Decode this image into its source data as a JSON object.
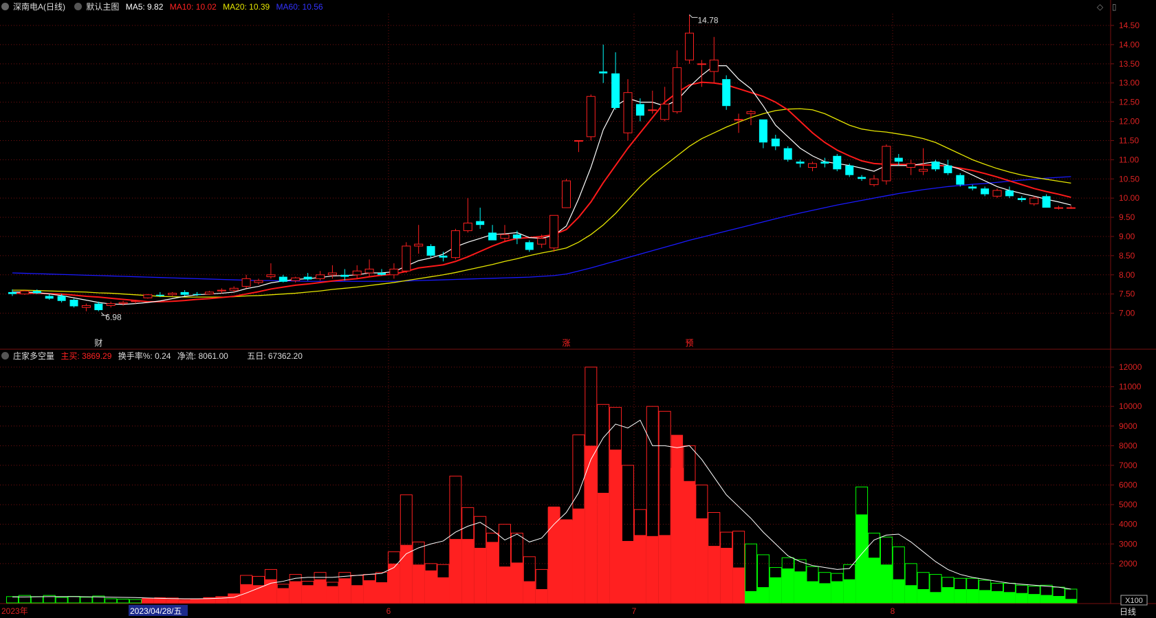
{
  "header": {
    "stock_name": "深南电A(日线)",
    "main_chart_label": "默认主图",
    "ma5": "MA5: 9.82",
    "ma10": "MA10: 10.02",
    "ma20": "MA20: 10.39",
    "ma60": "MA60: 10.56"
  },
  "indicator_header": {
    "name": "庄家多空量",
    "main_buy": "主买: 3869.29",
    "turnover": "换手率%: 0.24",
    "net_flow": "净流: 8061.00",
    "five_day": "五日: 67362.20"
  },
  "price_axis": {
    "ticks": [
      "14.50",
      "14.00",
      "13.50",
      "13.00",
      "12.50",
      "12.00",
      "11.50",
      "11.00",
      "10.50",
      "10.00",
      "9.50",
      "9.00",
      "8.50",
      "8.00",
      "7.50",
      "7.00"
    ],
    "max_label": "14.78",
    "min_label": "6.98"
  },
  "volume_axis": {
    "ticks": [
      "12000",
      "11000",
      "10000",
      "9000",
      "8000",
      "7000",
      "6000",
      "5000",
      "4000",
      "3000",
      "2000"
    ],
    "unit": "X100"
  },
  "time_axis": {
    "labels": [
      "2023年",
      "2023/04/28/五",
      "6",
      "7",
      "8"
    ]
  },
  "markers": {
    "cai": "财",
    "zhang": "涨",
    "yu": "预"
  },
  "footer": {
    "period": "日线"
  },
  "colors": {
    "up": "#ff2020",
    "down": "#00ffff",
    "ma5": "#ffffff",
    "ma10": "#ff1a1a",
    "ma20": "#e6e600",
    "ma60": "#1a1aff",
    "vol_down": "#00ff00",
    "grid": "#7a1010"
  },
  "chart_data": {
    "type": "candlestick",
    "candles": [
      {
        "o": 7.55,
        "h": 7.62,
        "l": 7.45,
        "c": 7.5
      },
      {
        "o": 7.5,
        "h": 7.6,
        "l": 7.48,
        "c": 7.58
      },
      {
        "o": 7.58,
        "h": 7.62,
        "l": 7.5,
        "c": 7.52
      },
      {
        "o": 7.45,
        "h": 7.5,
        "l": 7.35,
        "c": 7.38
      },
      {
        "o": 7.45,
        "h": 7.5,
        "l": 7.28,
        "c": 7.32
      },
      {
        "o": 7.35,
        "h": 7.38,
        "l": 7.15,
        "c": 7.18
      },
      {
        "o": 7.15,
        "h": 7.25,
        "l": 7.05,
        "c": 7.2
      },
      {
        "o": 7.25,
        "h": 7.3,
        "l": 7.05,
        "c": 7.08
      },
      {
        "o": 7.2,
        "h": 7.3,
        "l": 7.15,
        "c": 7.25
      },
      {
        "o": 7.25,
        "h": 7.32,
        "l": 7.2,
        "c": 7.28
      },
      {
        "o": 7.3,
        "h": 7.35,
        "l": 7.25,
        "c": 7.32
      },
      {
        "o": 7.4,
        "h": 7.5,
        "l": 7.38,
        "c": 7.48
      },
      {
        "o": 7.48,
        "h": 7.55,
        "l": 7.42,
        "c": 7.45
      },
      {
        "o": 7.48,
        "h": 7.55,
        "l": 7.45,
        "c": 7.52
      },
      {
        "o": 7.55,
        "h": 7.6,
        "l": 7.45,
        "c": 7.48
      },
      {
        "o": 7.5,
        "h": 7.55,
        "l": 7.45,
        "c": 7.48
      },
      {
        "o": 7.5,
        "h": 7.58,
        "l": 7.48,
        "c": 7.55
      },
      {
        "o": 7.58,
        "h": 7.65,
        "l": 7.52,
        "c": 7.6
      },
      {
        "o": 7.6,
        "h": 7.7,
        "l": 7.55,
        "c": 7.65
      },
      {
        "o": 7.7,
        "h": 8.0,
        "l": 7.65,
        "c": 7.9
      },
      {
        "o": 7.8,
        "h": 7.9,
        "l": 7.75,
        "c": 7.85
      },
      {
        "o": 7.95,
        "h": 8.3,
        "l": 7.9,
        "c": 8.0
      },
      {
        "o": 7.95,
        "h": 8.0,
        "l": 7.8,
        "c": 7.82
      },
      {
        "o": 7.85,
        "h": 7.95,
        "l": 7.8,
        "c": 7.92
      },
      {
        "o": 7.95,
        "h": 8.05,
        "l": 7.85,
        "c": 7.88
      },
      {
        "o": 7.9,
        "h": 8.1,
        "l": 7.85,
        "c": 8.0
      },
      {
        "o": 8.0,
        "h": 8.25,
        "l": 7.9,
        "c": 8.05
      },
      {
        "o": 8.0,
        "h": 8.15,
        "l": 7.85,
        "c": 7.95
      },
      {
        "o": 8.0,
        "h": 8.25,
        "l": 7.9,
        "c": 8.1
      },
      {
        "o": 8.05,
        "h": 8.4,
        "l": 7.95,
        "c": 8.15
      },
      {
        "o": 8.05,
        "h": 8.15,
        "l": 7.98,
        "c": 8.0
      },
      {
        "o": 8.0,
        "h": 8.3,
        "l": 7.9,
        "c": 8.15
      },
      {
        "o": 8.1,
        "h": 8.85,
        "l": 8.05,
        "c": 8.75
      },
      {
        "o": 8.75,
        "h": 9.3,
        "l": 8.55,
        "c": 8.8
      },
      {
        "o": 8.75,
        "h": 8.8,
        "l": 8.45,
        "c": 8.5
      },
      {
        "o": 8.5,
        "h": 8.6,
        "l": 8.35,
        "c": 8.45
      },
      {
        "o": 8.45,
        "h": 9.2,
        "l": 8.4,
        "c": 9.15
      },
      {
        "o": 9.15,
        "h": 10.0,
        "l": 9.1,
        "c": 9.35
      },
      {
        "o": 9.4,
        "h": 9.75,
        "l": 9.2,
        "c": 9.3
      },
      {
        "o": 9.1,
        "h": 9.3,
        "l": 8.9,
        "c": 8.9
      },
      {
        "o": 8.95,
        "h": 9.3,
        "l": 8.85,
        "c": 9.05
      },
      {
        "o": 9.05,
        "h": 9.15,
        "l": 8.8,
        "c": 8.95
      },
      {
        "o": 8.85,
        "h": 8.9,
        "l": 8.6,
        "c": 8.65
      },
      {
        "o": 8.8,
        "h": 9.05,
        "l": 8.7,
        "c": 8.95
      },
      {
        "o": 8.7,
        "h": 9.55,
        "l": 8.6,
        "c": 9.55
      },
      {
        "o": 9.75,
        "h": 10.5,
        "l": 9.75,
        "c": 10.45
      },
      {
        "o": 11.5,
        "h": 11.5,
        "l": 11.2,
        "c": 11.5
      },
      {
        "o": 11.6,
        "h": 12.7,
        "l": 11.5,
        "c": 12.65
      },
      {
        "o": 13.3,
        "h": 14.0,
        "l": 13.0,
        "c": 13.25
      },
      {
        "o": 13.25,
        "h": 13.8,
        "l": 12.3,
        "c": 12.35
      },
      {
        "o": 11.7,
        "h": 13.1,
        "l": 11.5,
        "c": 12.75
      },
      {
        "o": 12.45,
        "h": 12.6,
        "l": 12.0,
        "c": 12.15
      },
      {
        "o": 12.3,
        "h": 12.8,
        "l": 12.2,
        "c": 12.3
      },
      {
        "o": 12.05,
        "h": 12.9,
        "l": 12.0,
        "c": 12.45
      },
      {
        "o": 12.25,
        "h": 13.85,
        "l": 12.2,
        "c": 13.4
      },
      {
        "o": 13.6,
        "h": 14.78,
        "l": 13.5,
        "c": 14.3
      },
      {
        "o": 13.5,
        "h": 13.6,
        "l": 12.9,
        "c": 13.5
      },
      {
        "o": 13.3,
        "h": 14.2,
        "l": 13.0,
        "c": 13.6
      },
      {
        "o": 13.1,
        "h": 13.2,
        "l": 12.3,
        "c": 12.4
      },
      {
        "o": 12.05,
        "h": 12.2,
        "l": 11.7,
        "c": 12.05
      },
      {
        "o": 12.2,
        "h": 12.3,
        "l": 11.9,
        "c": 12.25
      },
      {
        "o": 12.05,
        "h": 12.05,
        "l": 11.3,
        "c": 11.45
      },
      {
        "o": 11.55,
        "h": 11.65,
        "l": 11.25,
        "c": 11.35
      },
      {
        "o": 11.3,
        "h": 11.35,
        "l": 10.95,
        "c": 11.0
      },
      {
        "o": 10.95,
        "h": 11.0,
        "l": 10.8,
        "c": 10.9
      },
      {
        "o": 10.8,
        "h": 10.95,
        "l": 10.7,
        "c": 10.9
      },
      {
        "o": 10.95,
        "h": 11.05,
        "l": 10.8,
        "c": 10.9
      },
      {
        "o": 11.1,
        "h": 11.15,
        "l": 10.7,
        "c": 10.75
      },
      {
        "o": 10.85,
        "h": 10.9,
        "l": 10.55,
        "c": 10.6
      },
      {
        "o": 10.55,
        "h": 10.6,
        "l": 10.45,
        "c": 10.5
      },
      {
        "o": 10.35,
        "h": 10.6,
        "l": 10.3,
        "c": 10.5
      },
      {
        "o": 10.45,
        "h": 11.4,
        "l": 10.35,
        "c": 11.35
      },
      {
        "o": 11.05,
        "h": 11.15,
        "l": 10.85,
        "c": 10.95
      },
      {
        "o": 10.8,
        "h": 11.0,
        "l": 10.6,
        "c": 10.9
      },
      {
        "o": 10.7,
        "h": 11.3,
        "l": 10.6,
        "c": 10.75
      },
      {
        "o": 10.95,
        "h": 11.0,
        "l": 10.7,
        "c": 10.75
      },
      {
        "o": 10.85,
        "h": 11.0,
        "l": 10.6,
        "c": 10.65
      },
      {
        "o": 10.6,
        "h": 10.65,
        "l": 10.3,
        "c": 10.35
      },
      {
        "o": 10.3,
        "h": 10.35,
        "l": 10.2,
        "c": 10.25
      },
      {
        "o": 10.25,
        "h": 10.3,
        "l": 10.05,
        "c": 10.1
      },
      {
        "o": 10.05,
        "h": 10.25,
        "l": 10.0,
        "c": 10.2
      },
      {
        "o": 10.2,
        "h": 10.3,
        "l": 10.0,
        "c": 10.05
      },
      {
        "o": 10.0,
        "h": 10.05,
        "l": 9.9,
        "c": 9.95
      },
      {
        "o": 9.85,
        "h": 10.05,
        "l": 9.8,
        "c": 10.0
      },
      {
        "o": 10.05,
        "h": 10.1,
        "l": 9.75,
        "c": 9.75
      },
      {
        "o": 9.75,
        "h": 9.8,
        "l": 9.7,
        "c": 9.75
      },
      {
        "o": 9.75,
        "h": 9.8,
        "l": 9.72,
        "c": 9.75
      }
    ],
    "ma5": [
      7.55,
      7.55,
      7.54,
      7.5,
      7.46,
      7.4,
      7.34,
      7.28,
      7.24,
      7.23,
      7.25,
      7.28,
      7.32,
      7.38,
      7.44,
      7.48,
      7.5,
      7.52,
      7.55,
      7.64,
      7.7,
      7.79,
      7.84,
      7.88,
      7.9,
      7.93,
      7.97,
      7.98,
      8.0,
      8.05,
      8.05,
      8.08,
      8.23,
      8.37,
      8.44,
      8.54,
      8.73,
      8.85,
      8.95,
      9.05,
      9.07,
      9.1,
      8.97,
      8.95,
      9.03,
      9.27,
      9.98,
      10.8,
      11.78,
      12.4,
      12.6,
      12.5,
      12.5,
      12.4,
      12.55,
      12.9,
      13.2,
      13.45,
      13.45,
      13.1,
      12.85,
      12.4,
      11.9,
      11.6,
      11.3,
      11.1,
      10.95,
      10.9,
      10.85,
      10.78,
      10.7,
      10.85,
      10.85,
      10.85,
      10.9,
      10.95,
      10.85,
      10.75,
      10.6,
      10.45,
      10.3,
      10.2,
      10.12,
      10.05,
      9.97,
      9.9,
      9.82
    ],
    "ma10": [
      7.52,
      7.52,
      7.52,
      7.51,
      7.5,
      7.47,
      7.44,
      7.42,
      7.39,
      7.36,
      7.33,
      7.3,
      7.3,
      7.31,
      7.33,
      7.36,
      7.38,
      7.41,
      7.44,
      7.5,
      7.56,
      7.63,
      7.68,
      7.73,
      7.76,
      7.8,
      7.84,
      7.87,
      7.9,
      7.95,
      7.99,
      8.02,
      8.09,
      8.18,
      8.22,
      8.26,
      8.35,
      8.47,
      8.61,
      8.75,
      8.87,
      8.95,
      8.97,
      9.0,
      9.05,
      9.18,
      9.5,
      9.9,
      10.4,
      10.85,
      11.3,
      11.7,
      12.1,
      12.5,
      12.75,
      12.95,
      13.02,
      13.0,
      12.95,
      12.85,
      12.75,
      12.65,
      12.5,
      12.3,
      12.0,
      11.7,
      11.45,
      11.25,
      11.1,
      10.97,
      10.9,
      10.88,
      10.88,
      10.87,
      10.86,
      10.86,
      10.83,
      10.78,
      10.72,
      10.64,
      10.55,
      10.45,
      10.35,
      10.25,
      10.17,
      10.1,
      10.02
    ],
    "ma20": [
      7.6,
      7.6,
      7.59,
      7.58,
      7.57,
      7.56,
      7.55,
      7.53,
      7.52,
      7.5,
      7.48,
      7.46,
      7.44,
      7.43,
      7.42,
      7.42,
      7.42,
      7.42,
      7.43,
      7.45,
      7.46,
      7.48,
      7.5,
      7.52,
      7.55,
      7.58,
      7.62,
      7.65,
      7.68,
      7.72,
      7.76,
      7.8,
      7.85,
      7.9,
      7.95,
      8.0,
      8.06,
      8.13,
      8.2,
      8.27,
      8.35,
      8.42,
      8.5,
      8.57,
      8.63,
      8.7,
      8.85,
      9.05,
      9.3,
      9.6,
      9.95,
      10.3,
      10.6,
      10.85,
      11.1,
      11.35,
      11.55,
      11.7,
      11.85,
      11.98,
      12.1,
      12.2,
      12.28,
      12.32,
      12.33,
      12.3,
      12.2,
      12.05,
      11.9,
      11.8,
      11.75,
      11.72,
      11.67,
      11.62,
      11.55,
      11.45,
      11.3,
      11.15,
      11.0,
      10.88,
      10.77,
      10.68,
      10.6,
      10.54,
      10.49,
      10.44,
      10.39
    ],
    "ma60": [
      8.05,
      8.04,
      8.03,
      8.02,
      8.01,
      8.0,
      7.99,
      7.98,
      7.97,
      7.96,
      7.95,
      7.94,
      7.93,
      7.92,
      7.91,
      7.9,
      7.89,
      7.88,
      7.87,
      7.86,
      7.85,
      7.85,
      7.84,
      7.84,
      7.83,
      7.83,
      7.83,
      7.83,
      7.83,
      7.83,
      7.83,
      7.83,
      7.84,
      7.85,
      7.86,
      7.87,
      7.88,
      7.89,
      7.9,
      7.91,
      7.92,
      7.93,
      7.94,
      7.96,
      7.98,
      8.02,
      8.1,
      8.18,
      8.27,
      8.36,
      8.45,
      8.54,
      8.63,
      8.72,
      8.81,
      8.9,
      8.98,
      9.06,
      9.14,
      9.22,
      9.3,
      9.38,
      9.46,
      9.54,
      9.61,
      9.68,
      9.75,
      9.82,
      9.88,
      9.94,
      10.0,
      10.06,
      10.12,
      10.17,
      10.22,
      10.26,
      10.3,
      10.33,
      10.36,
      10.38,
      10.41,
      10.44,
      10.47,
      10.49,
      10.52,
      10.54,
      10.56
    ],
    "volume_outline": [
      320,
      380,
      320,
      380,
      280,
      330,
      290,
      350,
      210,
      190,
      170,
      190,
      220,
      250,
      180,
      200,
      270,
      320,
      460,
      1400,
      1350,
      1700,
      950,
      1450,
      1100,
      1550,
      1050,
      1550,
      1400,
      1450,
      1550,
      2600,
      5500,
      3100,
      2000,
      1950,
      6450,
      4850,
      4400,
      3550,
      4000,
      3550,
      2350,
      1700,
      4850,
      4200,
      8550,
      12000,
      10100,
      9950,
      7000,
      4750,
      10000,
      9750,
      6850,
      8000,
      6000,
      4600,
      3600,
      3650,
      3000,
      2450,
      1800,
      2300,
      2200,
      1850,
      1550,
      1500,
      1950,
      5900,
      3550,
      3350,
      2850,
      2000,
      1550,
      1450,
      1300,
      1250,
      1250,
      1150,
      1000,
      1000,
      900,
      850,
      900,
      800,
      700
    ],
    "volume_fill": [
      0,
      0,
      0,
      0,
      0,
      0,
      0,
      0,
      0,
      0,
      0,
      250,
      280,
      200,
      150,
      200,
      270,
      320,
      460,
      950,
      900,
      1200,
      750,
      1100,
      900,
      1200,
      850,
      1250,
      900,
      1150,
      1050,
      2000,
      2950,
      1950,
      1650,
      1300,
      3250,
      3250,
      2800,
      3100,
      1850,
      2050,
      1100,
      700,
      4900,
      4250,
      4800,
      8000,
      5600,
      7800,
      3150,
      3450,
      3400,
      3450,
      8550,
      6200,
      4300,
      2900,
      2800,
      1800,
      600,
      800,
      1300,
      1750,
      1600,
      1100,
      1000,
      1100,
      1200,
      4500,
      2300,
      1950,
      1200,
      900,
      700,
      550,
      800,
      700,
      700,
      650,
      600,
      550,
      500,
      450,
      400,
      350,
      200
    ],
    "volume_side": [
      "down",
      "down",
      "down",
      "down",
      "down",
      "down",
      "down",
      "down",
      "down",
      "down",
      "down",
      "up",
      "up",
      "up",
      "up",
      "up",
      "up",
      "up",
      "up",
      "up",
      "up",
      "up",
      "up",
      "up",
      "up",
      "up",
      "up",
      "up",
      "up",
      "up",
      "up",
      "up",
      "up",
      "up",
      "up",
      "up",
      "up",
      "up",
      "up",
      "up",
      "up",
      "up",
      "up",
      "up",
      "up",
      "up",
      "up",
      "up",
      "up",
      "up",
      "up",
      "up",
      "up",
      "up",
      "up",
      "up",
      "up",
      "up",
      "up",
      "up",
      "down",
      "down",
      "down",
      "down",
      "down",
      "down",
      "down",
      "down",
      "down",
      "down",
      "down",
      "down",
      "down",
      "down",
      "down",
      "down",
      "down",
      "down",
      "down",
      "down",
      "down",
      "down",
      "down",
      "down",
      "down",
      "down",
      "down"
    ],
    "volume_ma": [
      300,
      300,
      310,
      320,
      320,
      320,
      310,
      300,
      290,
      280,
      270,
      250,
      230,
      220,
      210,
      210,
      220,
      240,
      280,
      500,
      750,
      1000,
      1100,
      1250,
      1300,
      1300,
      1300,
      1350,
      1400,
      1450,
      1500,
      1800,
      2500,
      2800,
      3000,
      3150,
      3600,
      3900,
      4100,
      3700,
      3200,
      3500,
      3100,
      3300,
      4000,
      4600,
      5600,
      7300,
      8400,
      9100,
      8900,
      9300,
      8000,
      8000,
      7900,
      8000,
      7300,
      6400,
      5500,
      4900,
      4300,
      3600,
      3000,
      2400,
      2100,
      1900,
      1800,
      1700,
      1750,
      2500,
      3200,
      3450,
      3500,
      3100,
      2600,
      2100,
      1700,
      1450,
      1300,
      1200,
      1100,
      1000,
      950,
      900,
      850,
      800,
      700
    ]
  }
}
